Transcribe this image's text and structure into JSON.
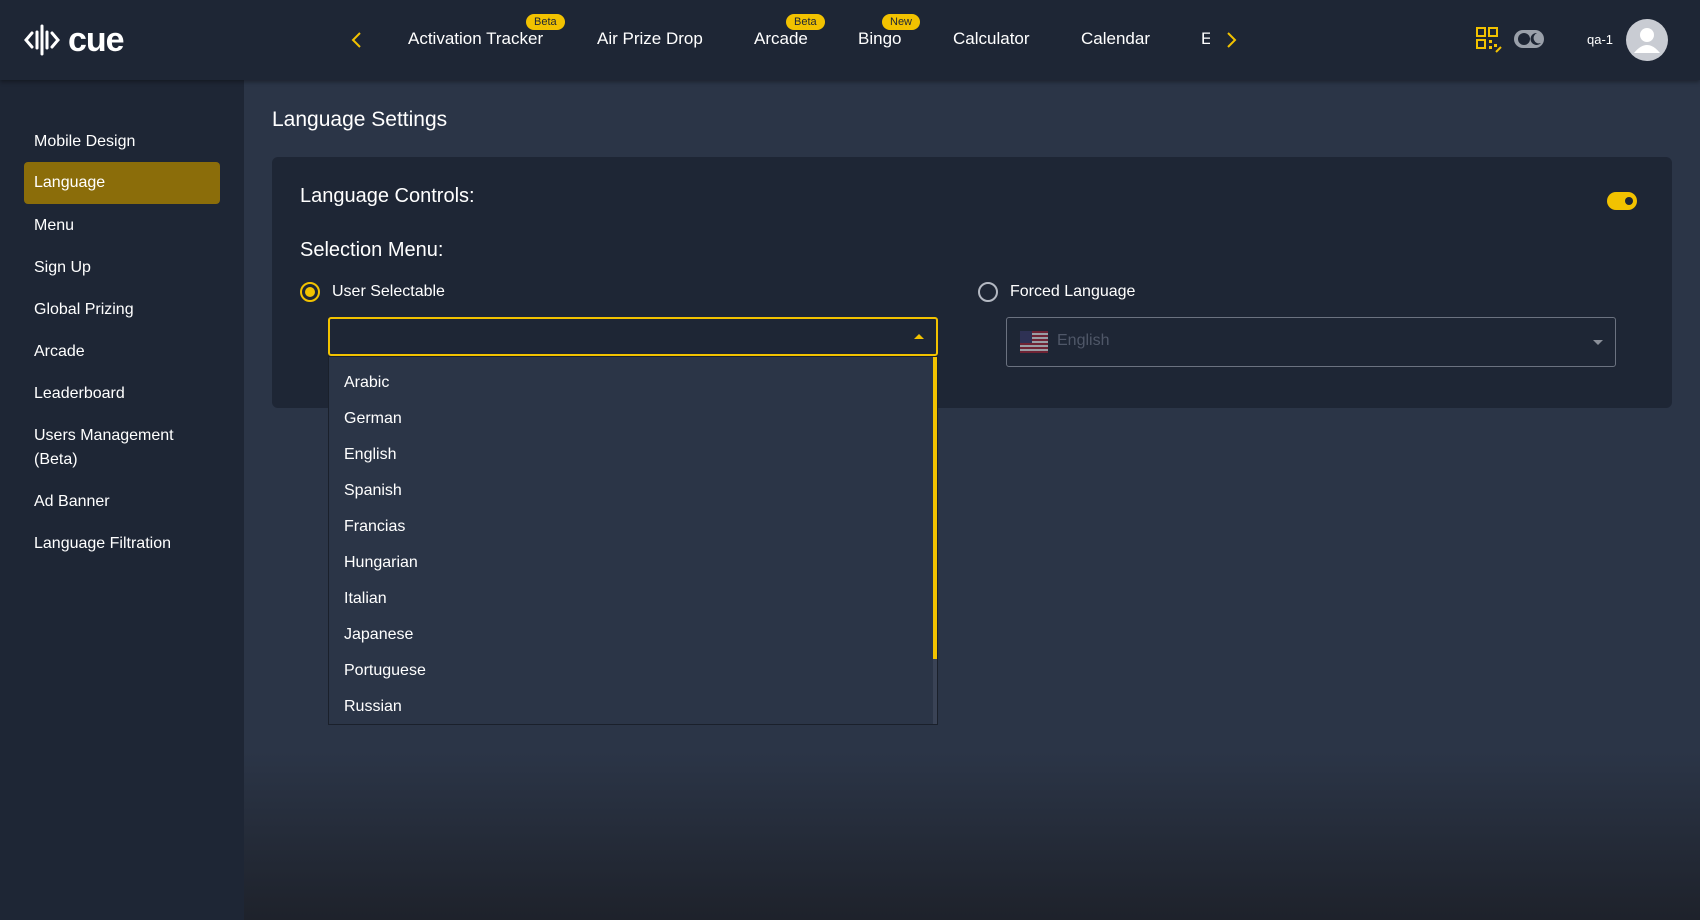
{
  "app": {
    "logo_text": "cue"
  },
  "nav": {
    "tabs": [
      {
        "label": "Activation Tracker",
        "badge": "Beta"
      },
      {
        "label": "Air Prize Drop",
        "badge": ""
      },
      {
        "label": "Arcade",
        "badge": "Beta"
      },
      {
        "label": "Bingo",
        "badge": "New"
      },
      {
        "label": "Calculator",
        "badge": ""
      },
      {
        "label": "Calendar",
        "badge": ""
      },
      {
        "label": "E",
        "badge": ""
      }
    ]
  },
  "header": {
    "username": "qa-1"
  },
  "sidebar": {
    "items": [
      {
        "label": "Mobile Design"
      },
      {
        "label": "Language",
        "active": true
      },
      {
        "label": "Menu"
      },
      {
        "label": "Sign Up"
      },
      {
        "label": "Global Prizing"
      },
      {
        "label": "Arcade"
      },
      {
        "label": "Leaderboard"
      },
      {
        "label": "Users Management (Beta)"
      },
      {
        "label": "Ad Banner"
      },
      {
        "label": "Language Filtration"
      }
    ]
  },
  "page": {
    "title": "Language Settings",
    "controls_label": "Language Controls:",
    "controls_enabled": true,
    "selection_menu_label": "Selection Menu:",
    "user_selectable": {
      "label": "User Selectable",
      "checked": true,
      "value": ""
    },
    "forced_language": {
      "label": "Forced Language",
      "checked": false,
      "value": "English",
      "flag": "us-flag-icon"
    }
  },
  "dropdown": {
    "options": [
      "Arabic",
      "German",
      "English",
      "Spanish",
      "Francias",
      "Hungarian",
      "Italian",
      "Japanese",
      "Portuguese",
      "Russian"
    ]
  },
  "colors": {
    "accent": "#f2c200",
    "active_nav_bg": "#8b6d0a",
    "panel_bg": "#1e2635",
    "page_bg": "#2b3547"
  }
}
